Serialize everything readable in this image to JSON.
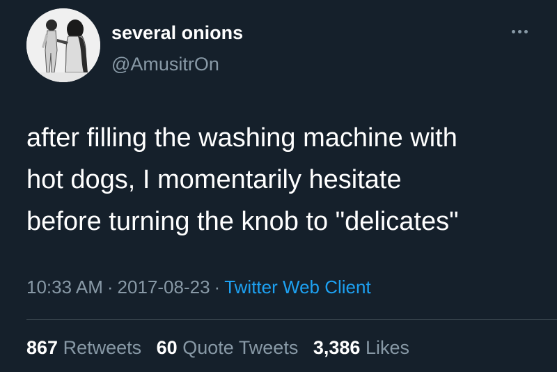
{
  "user": {
    "display_name": "several onions",
    "handle": "@AmusitrOn",
    "avatar_icon": "avatar-photo"
  },
  "menu": {
    "more_icon": "more-options-icon"
  },
  "tweet": {
    "text_lines": [
      "after filling the washing machine with",
      "hot dogs, I momentarily hesitate",
      "before turning the knob to \"delicates\""
    ]
  },
  "meta": {
    "time": "10:33 AM",
    "date": "2017-08-23",
    "separator": "·",
    "client": "Twitter Web Client"
  },
  "stats": {
    "retweets_count": "867",
    "retweets_label": "Retweets",
    "quotes_count": "60",
    "quotes_label": "Quote Tweets",
    "likes_count": "3,386",
    "likes_label": "Likes"
  },
  "colors": {
    "background": "#15202b",
    "primary_text": "#ffffff",
    "secondary_text": "#8899a6",
    "link": "#1da1f2",
    "divider": "#38444d"
  }
}
